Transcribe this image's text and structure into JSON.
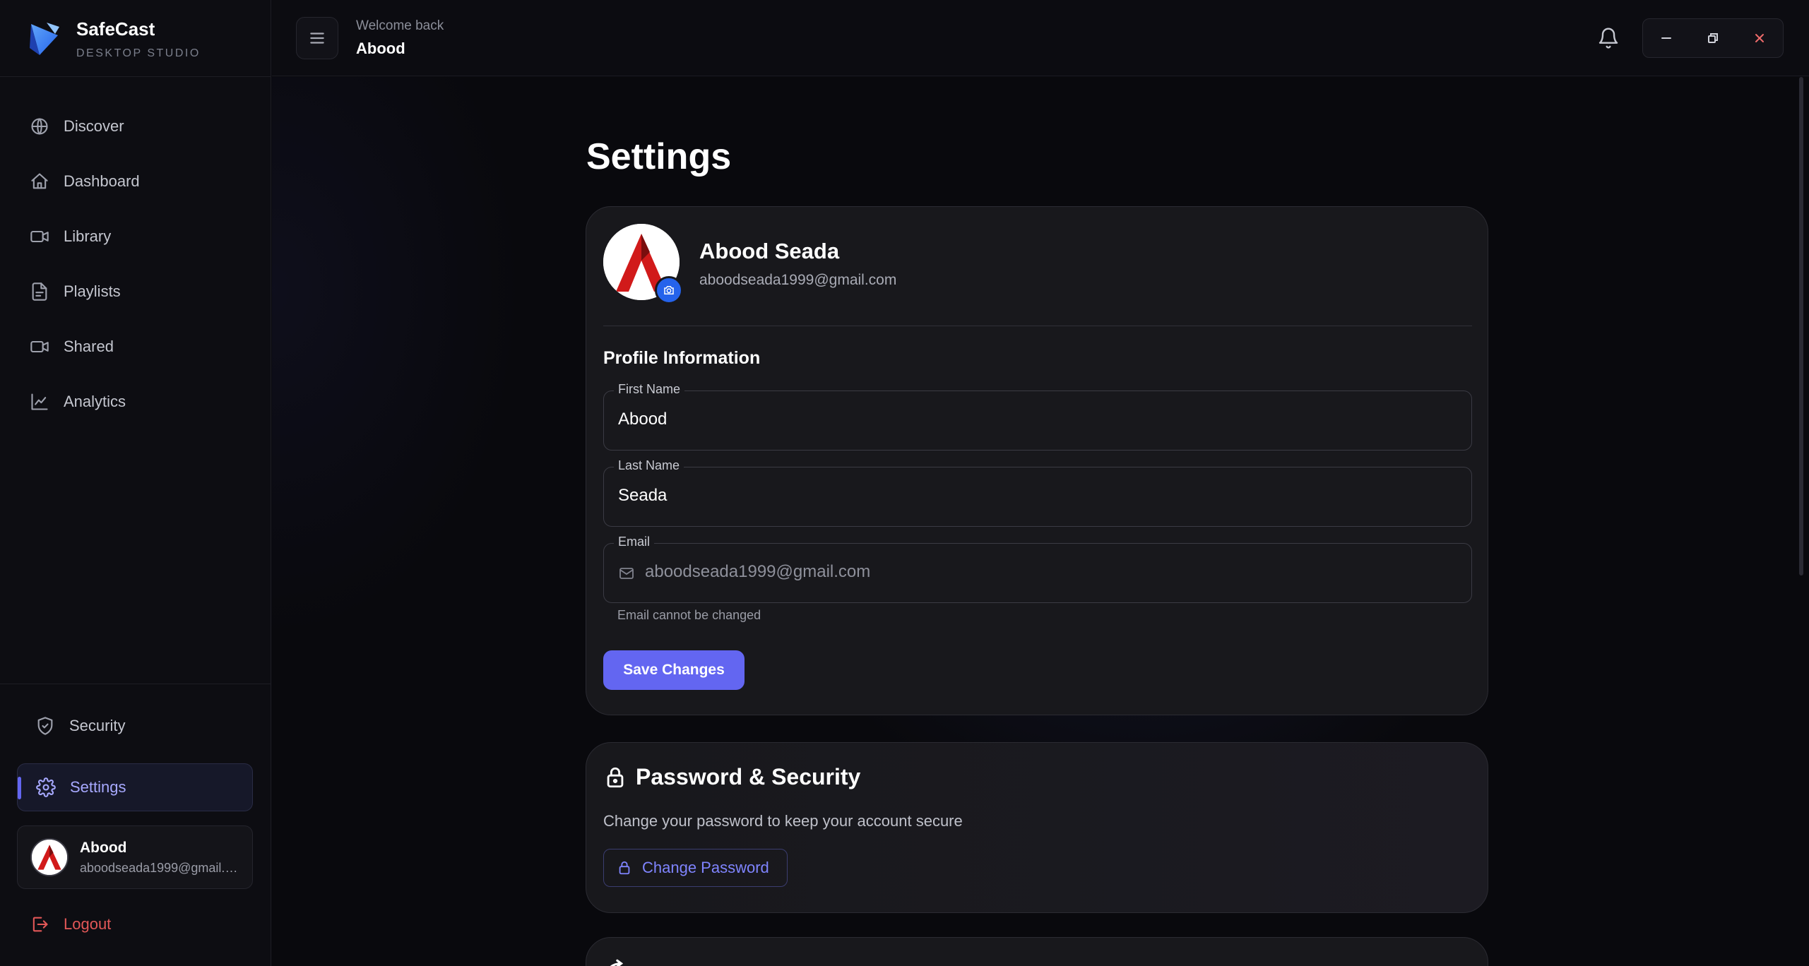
{
  "brand": {
    "name": "SafeCast",
    "subtitle": "DESKTOP STUDIO"
  },
  "sidebar": {
    "items": [
      {
        "label": "Discover",
        "icon": "globe-icon"
      },
      {
        "label": "Dashboard",
        "icon": "home-icon"
      },
      {
        "label": "Library",
        "icon": "video-icon"
      },
      {
        "label": "Playlists",
        "icon": "file-icon"
      },
      {
        "label": "Shared",
        "icon": "video-icon"
      },
      {
        "label": "Analytics",
        "icon": "chart-line-icon"
      }
    ],
    "security_label": "Security",
    "settings_label": "Settings",
    "user": {
      "name": "Abood",
      "email": "aboodseada1999@gmail.com"
    },
    "logout_label": "Logout"
  },
  "topbar": {
    "welcome_label": "Welcome back",
    "welcome_name": "Abood"
  },
  "page": {
    "title": "Settings"
  },
  "profile": {
    "name": "Abood Seada",
    "email": "aboodseada1999@gmail.com",
    "section_title": "Profile Information",
    "fields": {
      "first_name": {
        "label": "First Name",
        "value": "Abood"
      },
      "last_name": {
        "label": "Last Name",
        "value": "Seada"
      },
      "email": {
        "label": "Email",
        "value": "aboodseada1999@gmail.com",
        "helper": "Email cannot be changed"
      }
    },
    "save_label": "Save Changes"
  },
  "password": {
    "title": "Password & Security",
    "description": "Change your password to keep your account secure",
    "button_label": "Change Password"
  },
  "colors": {
    "accent": "#6366f1",
    "danger": "#e25757",
    "badge": "#2563eb"
  }
}
